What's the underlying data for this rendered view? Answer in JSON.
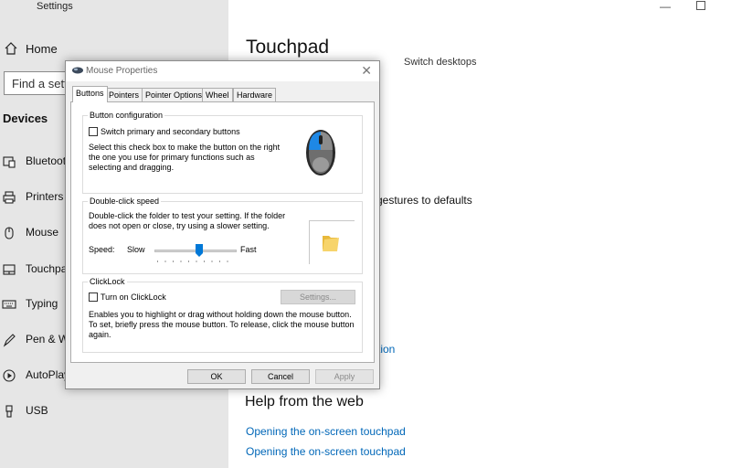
{
  "settings": {
    "title": "Settings",
    "home_label": "Home",
    "search_placeholder": "Find a setting",
    "search_visible": "Find a settin",
    "section_heading": "Devices",
    "nav_items": [
      {
        "label": "Bluetooth",
        "icon": "bluetooth-icon"
      },
      {
        "label": "Printers &",
        "icon": "printer-icon"
      },
      {
        "label": "Mouse",
        "icon": "mouse-icon"
      },
      {
        "label": "Touchpad",
        "icon": "touchpad-icon"
      },
      {
        "label": "Typing",
        "icon": "keyboard-icon"
      },
      {
        "label": "Pen & W",
        "icon": "pen-icon"
      },
      {
        "label": "AutoPlay",
        "icon": "autoplay-icon"
      },
      {
        "label": "USB",
        "icon": "usb-icon"
      }
    ],
    "window_min": "—",
    "main": {
      "title": "Touchpad",
      "switch_desktops": "Switch desktops",
      "reset_text": "gestures to defaults",
      "partial_link": "tion",
      "help_heading": "Help from the web",
      "help_links": [
        "Opening the on-screen touchpad",
        "Opening the on-screen touchpad"
      ]
    }
  },
  "dialog": {
    "title": "Mouse Properties",
    "close": "✕",
    "tabs": [
      "Buttons",
      "Pointers",
      "Pointer Options",
      "Wheel",
      "Hardware"
    ],
    "active_tab": "Buttons",
    "button_config": {
      "title": "Button configuration",
      "checkbox_label": "Switch primary and secondary buttons",
      "description": [
        "Select this check box to make the button on the right",
        "the one you use for primary functions such as",
        "selecting and dragging."
      ]
    },
    "double_click": {
      "title": "Double-click speed",
      "description": [
        "Double-click the folder to test your setting. If the folder",
        "does not open or close, try using a slower setting."
      ],
      "speed_label": "Speed:",
      "slow_label": "Slow",
      "fast_label": "Fast",
      "speed_level": 0.55
    },
    "clicklock": {
      "title": "ClickLock",
      "checkbox_label": "Turn on ClickLock",
      "settings_label": "Settings...",
      "description": [
        "Enables you to highlight or drag without holding down the mouse button.",
        "To set, briefly press the mouse button. To release, click the mouse button",
        "again."
      ]
    },
    "buttons": {
      "ok": "OK",
      "cancel": "Cancel",
      "apply": "Apply"
    }
  },
  "colors": {
    "accent": "#0067b8",
    "sidebar_bg": "#e6e6e6",
    "dialog_bg": "#f0f0f0"
  }
}
